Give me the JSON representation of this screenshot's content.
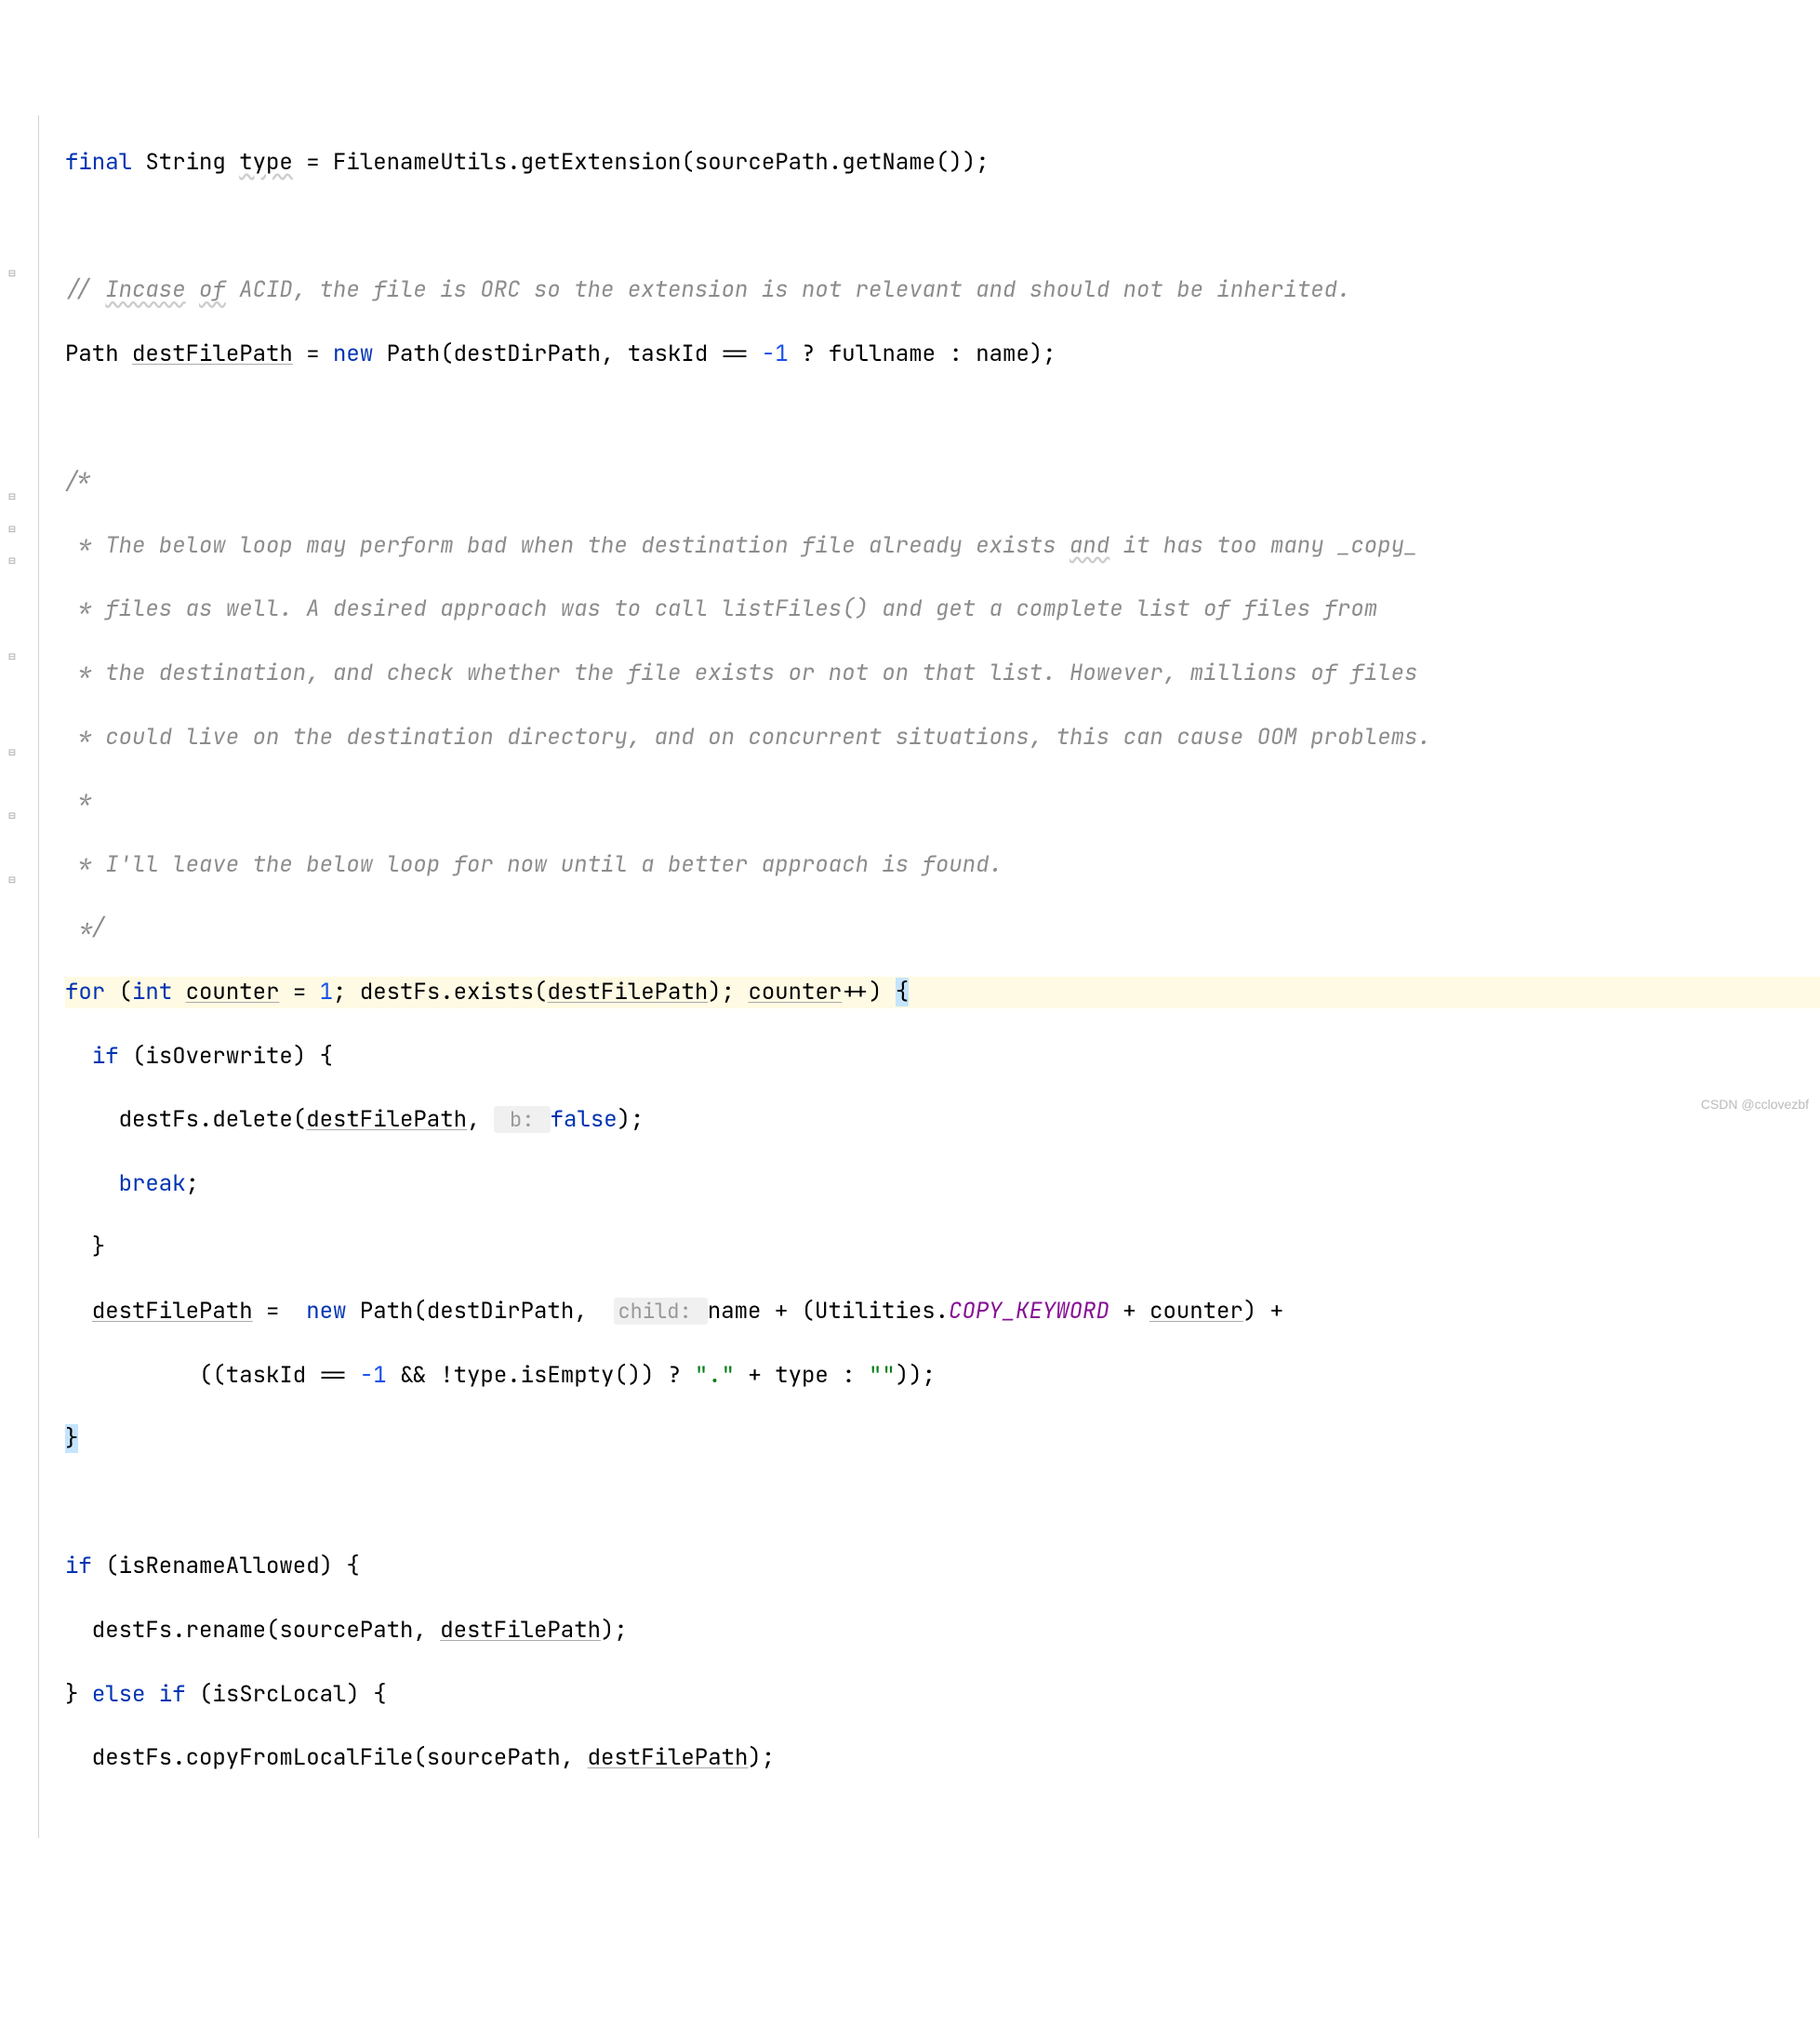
{
  "code": {
    "line0": {
      "final": "final",
      "string_type": "String",
      "type_var": "type",
      "filenameutils": "FilenameUtils",
      "getextension": ".getExtension(sourcePath.getName());"
    },
    "line2": {
      "comment": "// ",
      "incase": "Incase",
      "space": " ",
      "of": "of",
      "rest": " ACID, the file is ORC so the extension is not relevant and should not be inherited."
    },
    "line3": {
      "path": "Path ",
      "destfilepath": "destFilePath",
      "equals": " = ",
      "new": "new",
      "path2": " Path(destDirPath, taskId == ",
      "neg1": "-1",
      "ternary": " ? fullname : name);"
    },
    "comment_block": {
      "open": "/*",
      "l1": " * The below loop may perform bad when the destination file already exists ",
      "l1_and": "and",
      "l1_rest": " it has too many _copy_",
      "l2": " * files as well. A desired approach was to call listFiles() and get a complete list of files from",
      "l3": " * the destination, and check whether the file exists or not on that list. However, millions of files",
      "l4": " * could live on the destination directory, and on concurrent situations, this can cause OOM problems.",
      "l5": " *",
      "l6": " * I'll leave the below loop for now until a better approach is found.",
      "close": " */"
    },
    "for_line": {
      "for": "for",
      "open": " (",
      "int": "int",
      "space": " ",
      "counter": "counter",
      "eq": " = ",
      "one": "1",
      "semi": "; destFs.exists(",
      "destfilepath": "destFilePath",
      "close_exists": "); ",
      "counter2": "counter",
      "inc": "++) ",
      "brace": "{"
    },
    "if_overwrite": {
      "indent": "  ",
      "if": "if",
      "cond": " (isOverwrite) {"
    },
    "delete_line": {
      "indent": "    ",
      "call": "destFs.delete(",
      "dfp": "destFilePath",
      "comma": ", ",
      "hint": " b: ",
      "false": "false",
      "end": ");"
    },
    "break_line": {
      "indent": "    ",
      "break": "break",
      "semi": ";"
    },
    "close_if": "  }",
    "destfilepath_assign": {
      "indent": "  ",
      "dfp": "destFilePath",
      "eq": " =  ",
      "new": "new",
      "path": " Path(destDirPath,  ",
      "hint": "child: ",
      "name": "name + (Utilities.",
      "copy": "COPY_KEYWORD",
      "plus_counter": " + ",
      "counter": "counter",
      "end": ") +"
    },
    "continuation": {
      "indent": "          ",
      "expr1": "((taskId == ",
      "neg1": "-1",
      "and": " && !type.isEmpty()) ? ",
      "dot": "\".\"",
      "plus": " + type : ",
      "empty": "\"\"",
      "end": "));"
    },
    "close_for": "}",
    "if_rename": {
      "if": "if",
      "cond": " (isRenameAllowed) {"
    },
    "rename_line": {
      "indent": "  ",
      "call": "destFs.rename(sourcePath, ",
      "dfp": "destFilePath",
      "end": ");"
    },
    "else_if": {
      "close": "} ",
      "else": "else if",
      "cond": " (isSrcLocal) {"
    },
    "copy_line": {
      "indent": "  ",
      "call": "destFs.copyFromLocalFile(sourcePath, ",
      "dfp": "destFilePath",
      "end": ");"
    }
  },
  "watermark": "CSDN @cclovezbf"
}
